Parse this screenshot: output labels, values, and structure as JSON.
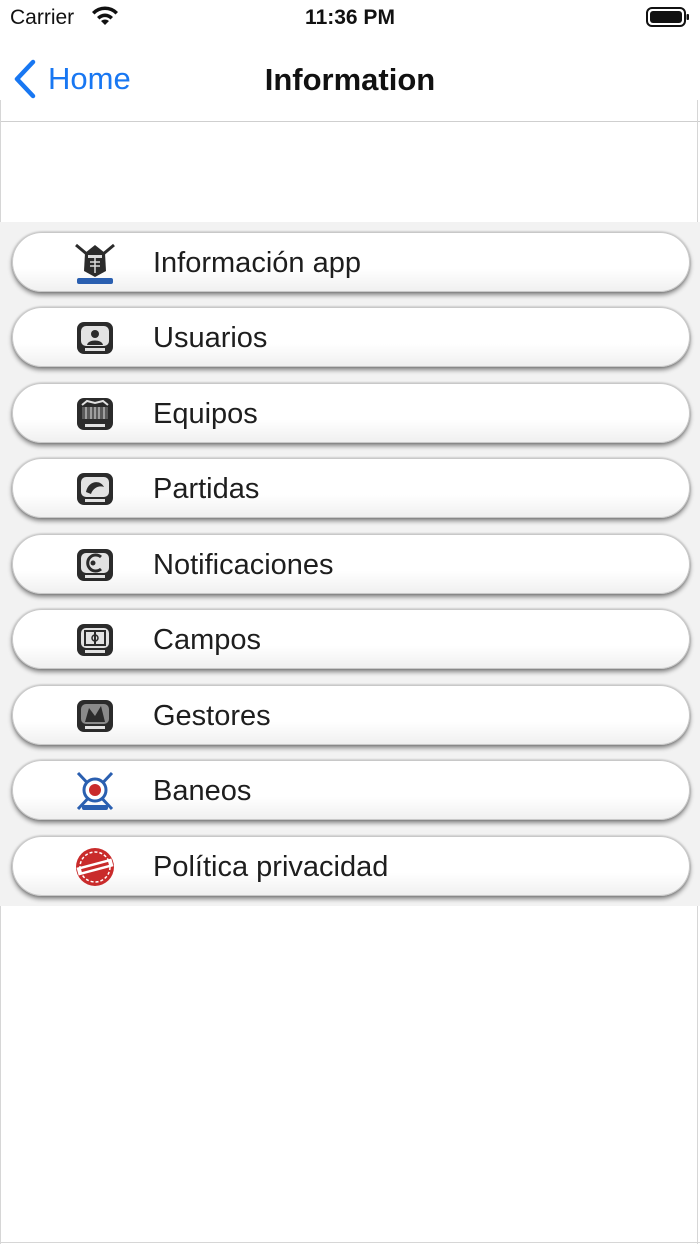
{
  "status_bar": {
    "carrier": "Carrier",
    "time": "11:36 PM",
    "wifi_icon": "wifi-icon",
    "battery_icon": "battery-full-icon"
  },
  "nav": {
    "back_label": "Home",
    "back_icon": "chevron-left-icon",
    "title": "Information"
  },
  "colors": {
    "accent": "#1877f2",
    "menu_background": "#f2f2f2",
    "icon_dark": "#2b2b2b",
    "icon_blue": "#2a5fb0",
    "icon_red": "#c92b2b"
  },
  "menu": {
    "items": [
      {
        "label": "Información app",
        "icon": "knight-helmet-icon"
      },
      {
        "label": "Usuarios",
        "icon": "users-badge-icon"
      },
      {
        "label": "Equipos",
        "icon": "teams-badge-icon"
      },
      {
        "label": "Partidas",
        "icon": "matches-badge-icon"
      },
      {
        "label": "Notificaciones",
        "icon": "notifications-badge-icon"
      },
      {
        "label": "Campos",
        "icon": "fields-badge-icon"
      },
      {
        "label": "Gestores",
        "icon": "managers-badge-icon"
      },
      {
        "label": "Baneos",
        "icon": "bans-emblem-icon"
      },
      {
        "label": "Política privacidad",
        "icon": "privacy-stamp-icon"
      }
    ]
  }
}
